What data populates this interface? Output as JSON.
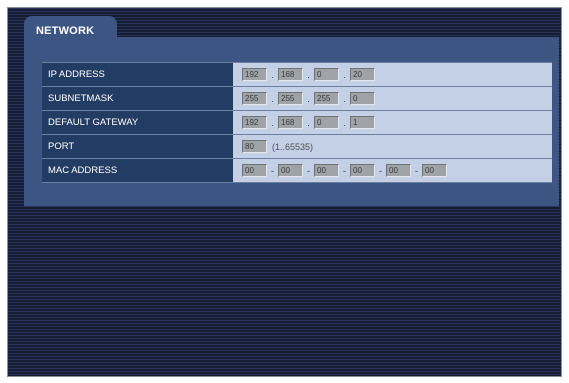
{
  "tab": {
    "label": "NETWORK"
  },
  "rows": [
    {
      "label": "IP ADDRESS",
      "fields": [
        "192",
        "168",
        "0",
        "20"
      ],
      "separator": "."
    },
    {
      "label": "SUBNETMASK",
      "fields": [
        "255",
        "255",
        "255",
        "0"
      ],
      "separator": "."
    },
    {
      "label": "DEFAULT GATEWAY",
      "fields": [
        "192",
        "168",
        "0",
        "1"
      ],
      "separator": "."
    },
    {
      "label": "PORT",
      "fields": [
        "80"
      ],
      "hint": "(1..65535)"
    },
    {
      "label": "MAC ADDRESS",
      "fields": [
        "00",
        "00",
        "00",
        "00",
        "00",
        "00"
      ],
      "separator": "-"
    }
  ]
}
